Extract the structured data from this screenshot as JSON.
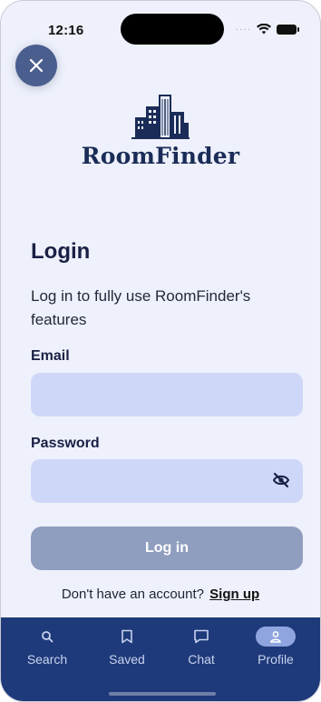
{
  "status_bar": {
    "time": "12:16"
  },
  "brand": {
    "name": "RoomFinder"
  },
  "login": {
    "title": "Login",
    "subtitle": "Log in to fully use RoomFinder's features",
    "email_label": "Email",
    "email_value": "",
    "password_label": "Password",
    "password_value": "",
    "button_label": "Log in",
    "no_account_text": "Don't have an account?",
    "signup_label": "Sign up"
  },
  "tabs": [
    {
      "label": "Search",
      "icon": "search-icon"
    },
    {
      "label": "Saved",
      "icon": "bookmark-icon"
    },
    {
      "label": "Chat",
      "icon": "chat-icon"
    },
    {
      "label": "Profile",
      "icon": "profile-icon",
      "active": true
    }
  ],
  "colors": {
    "background": "#eef1fb",
    "input_fill": "#cfd7f9",
    "button_disabled": "#8f9dbf",
    "tabbar": "#1f3a7a",
    "brand_text": "#1a2c57",
    "close_button": "#4a5f8e"
  }
}
